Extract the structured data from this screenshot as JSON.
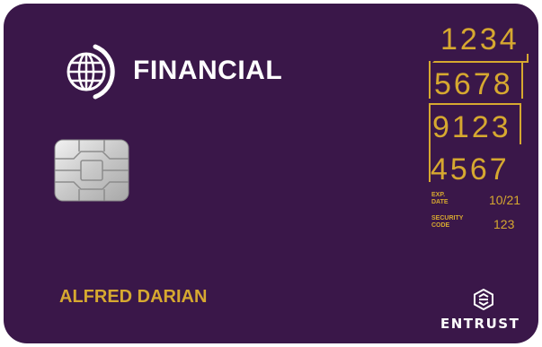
{
  "card": {
    "brand": "FINANCIAL",
    "number_groups": [
      "1234",
      "5678",
      "9123",
      "4567"
    ],
    "expiry": {
      "label": "EXP.\nDATE",
      "value": "10/21"
    },
    "security": {
      "label": "SECURITY\nCODE",
      "value": "123"
    },
    "cardholder": "ALFRED DARIAN",
    "issuer_mark": "ENTRUST"
  },
  "colors": {
    "card_background": "#3a1749",
    "gold_text": "#d6a830",
    "white_text": "#ffffff"
  },
  "icons": {
    "logo": "globe-icon",
    "chip": "emv-chip-icon",
    "issuer": "entrust-hexagon-icon"
  }
}
